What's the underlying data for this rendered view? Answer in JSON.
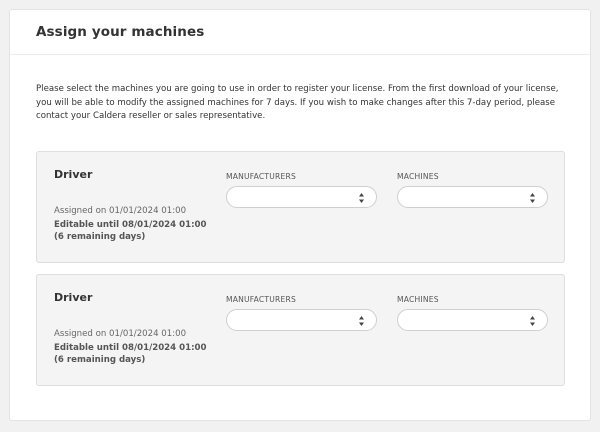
{
  "card": {
    "title": "Assign your machines",
    "intro": "Please select the machines you are going to use in order to register your license. From the first download of your license, you will be able to modify the assigned machines for 7 days. If you wish to make changes after this 7-day period, please contact your Caldera reseller or sales representative."
  },
  "machines": [
    {
      "name": "Driver",
      "assigned_on": "Assigned on 01/01/2024 01:00",
      "editable_until": "Editable until 08/01/2024 01:00",
      "remaining": "(6 remaining days)",
      "manufacturers_label": "MANUFACTURERS",
      "manufacturers_value": "",
      "machines_label": "MACHINES",
      "machines_value": ""
    },
    {
      "name": "Driver",
      "assigned_on": "Assigned on 01/01/2024 01:00",
      "editable_until": "Editable until 08/01/2024 01:00",
      "remaining": "(6 remaining days)",
      "manufacturers_label": "MANUFACTURERS",
      "manufacturers_value": "",
      "machines_label": "MACHINES",
      "machines_value": ""
    }
  ]
}
